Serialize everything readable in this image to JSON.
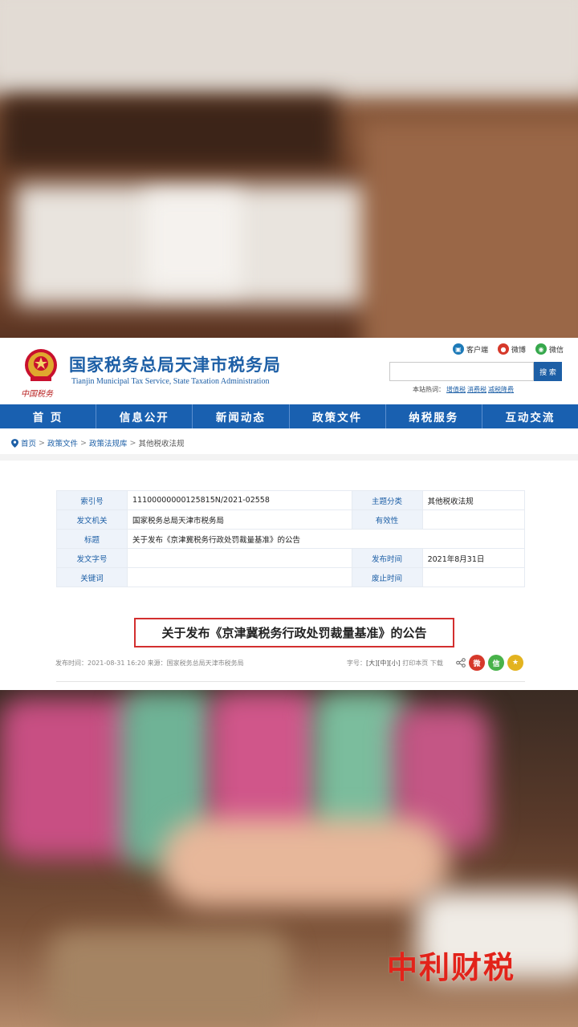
{
  "header": {
    "emblem_caption": "中国税务",
    "title_cn": "国家税务总局天津市税务局",
    "title_en": "Tianjin Municipal Tax Service, State Taxation Administration",
    "top_links": [
      {
        "label": "客户端",
        "icon": "client-icon",
        "color": "#1d7ab8"
      },
      {
        "label": "微博",
        "icon": "weibo-icon",
        "color": "#d6392b"
      },
      {
        "label": "微信",
        "icon": "wechat-icon",
        "color": "#36a84c"
      }
    ],
    "search": {
      "placeholder": "",
      "button": "搜 索"
    },
    "hot": {
      "label": "本站热词：",
      "terms": [
        "增值税",
        "消费税",
        "减税降费"
      ]
    }
  },
  "nav": {
    "items": [
      "首 页",
      "信息公开",
      "新闻动态",
      "政策文件",
      "纳税服务",
      "互动交流"
    ]
  },
  "breadcrumb": [
    "首页",
    "政策文件",
    "政策法规库",
    "其他税收法规"
  ],
  "meta": {
    "index_label": "索引号",
    "index_value": "11100000000125815N/2021-02558",
    "topic_label": "主题分类",
    "topic_value": "其他税收法规",
    "issuer_label": "发文机关",
    "issuer_value": "国家税务总局天津市税务局",
    "validity_label": "有效性",
    "validity_value": "",
    "title_label": "标题",
    "title_value": "关于发布《京津冀税务行政处罚裁量基准》的公告",
    "docno_label": "发文字号",
    "docno_value": "",
    "pubtime_label": "发布时间",
    "pubtime_value": "2021年8月31日",
    "keyword_label": "关键词",
    "keyword_value": "",
    "abolish_label": "废止时间",
    "abolish_value": ""
  },
  "doc": {
    "title": "关于发布《京津冀税务行政处罚裁量基准》的公告",
    "pub_info": "发布时间：2021-08-31 16:20  来源：国家税务总局天津市税务局",
    "font_size_label": "字号：",
    "font_large": "[大]",
    "font_medium": "[中]",
    "font_small": "[小]",
    "print": "打印本页",
    "download": "下载"
  },
  "share": [
    {
      "icon": "share-icon"
    },
    {
      "icon": "weibo-share-icon",
      "color": "#d6392b",
      "glyph": "微"
    },
    {
      "icon": "wechat-share-icon",
      "color": "#48b24a",
      "glyph": "信"
    },
    {
      "icon": "favorite-icon",
      "color": "#e3b31f",
      "glyph": "★"
    }
  ],
  "watermark": "中利财税"
}
